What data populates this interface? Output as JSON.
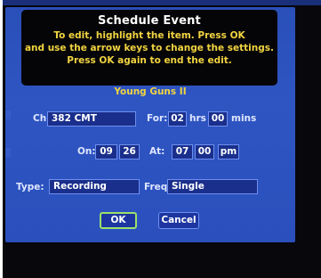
{
  "dialog": {
    "title": "Schedule Event",
    "instructions": [
      "To edit, highlight the item. Press OK",
      "and use the arrow keys to change the settings.",
      "Press OK again to end the edit."
    ],
    "program_name": "Young Guns II"
  },
  "channel": {
    "label": "Ch:",
    "value": "382 CMT"
  },
  "duration": {
    "label": "For:",
    "hours": "02",
    "hours_unit": "hrs",
    "minutes": "00",
    "minutes_unit": "mins"
  },
  "date": {
    "label": "On:",
    "month": "09",
    "day": "26"
  },
  "time": {
    "label": "At:",
    "hour": "07",
    "minute": "00",
    "ampm": "pm"
  },
  "type": {
    "label": "Type:",
    "value": "Recording"
  },
  "frequency": {
    "label": "Freq:",
    "value": "Single"
  },
  "buttons": {
    "ok": "OK",
    "cancel": "Cancel"
  },
  "colors": {
    "panel": "#2e55c2",
    "field": "#1a2f8c",
    "instruction_text": "#f1d441",
    "focus_border": "#9be06a"
  }
}
